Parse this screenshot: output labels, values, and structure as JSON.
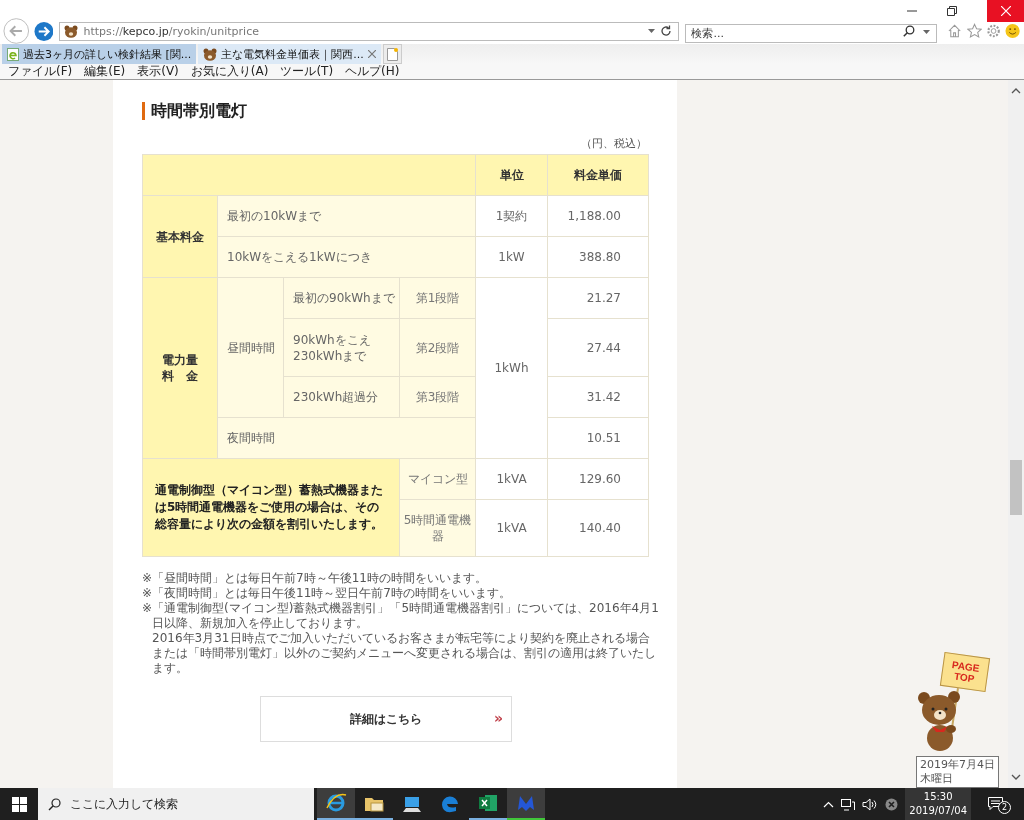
{
  "address_bar": {
    "url_prefix": "https://",
    "url_host": "kepco.jp",
    "url_path": "/ryokin/unitprice"
  },
  "search": {
    "placeholder": "検索..."
  },
  "tabs": [
    {
      "label": "過去3ヶ月の詳しい検針結果 [関...",
      "selected": false
    },
    {
      "label": "主な電気料金単価表｜関西...",
      "selected": true
    }
  ],
  "menu": [
    "ファイル(F)",
    "編集(E)",
    "表示(V)",
    "お気に入り(A)",
    "ツール(T)",
    "ヘルプ(H)"
  ],
  "page": {
    "heading": "時間帯別電灯",
    "unit_note": "（円、税込）",
    "table": {
      "rows": [
        [
          {
            "kind": "blank",
            "colspan": 4
          },
          {
            "kind": "header",
            "text": "単位"
          },
          {
            "kind": "header",
            "text": "料金単価"
          }
        ],
        [
          {
            "kind": "group",
            "text": "基本料金",
            "rowspan": 2
          },
          {
            "kind": "label",
            "text": "最初の10kWまで",
            "colspan": 3
          },
          {
            "kind": "value",
            "text": "1契約"
          },
          {
            "kind": "price",
            "text": "1,188.00"
          }
        ],
        [
          {
            "kind": "label",
            "text": "10kWをこえる1kWにつき",
            "colspan": 3
          },
          {
            "kind": "value",
            "text": "1kW"
          },
          {
            "kind": "price",
            "text": "388.80"
          }
        ],
        [
          {
            "kind": "group",
            "lines": [
              "電力量",
              "料　金"
            ],
            "rowspan": 4
          },
          {
            "kind": "label",
            "text": "昼間時間",
            "rowspan": 3
          },
          {
            "kind": "label",
            "text": "最初の90kWhまで"
          },
          {
            "kind": "stage",
            "text": "第1段階"
          },
          {
            "kind": "value",
            "text": "1kWh",
            "rowspan": 4
          },
          {
            "kind": "price",
            "text": "21.27"
          }
        ],
        [
          {
            "kind": "label",
            "lines": [
              "90kWhをこえ",
              "230kWhまで"
            ]
          },
          {
            "kind": "stage",
            "text": "第2段階"
          },
          {
            "kind": "price",
            "text": "27.44"
          }
        ],
        [
          {
            "kind": "label",
            "text": "230kWh超過分"
          },
          {
            "kind": "stage",
            "text": "第3段階"
          },
          {
            "kind": "price",
            "text": "31.42"
          }
        ],
        [
          {
            "kind": "label",
            "text": "夜間時間",
            "colspan": 3
          },
          {
            "kind": "price",
            "text": "10.51"
          }
        ],
        [
          {
            "kind": "note",
            "text": "通電制御型（マイコン型）蓄熱式機器または5時間通電機器をご使用の場合は、その総容量により次の金額を割引いたします。",
            "colspan": 3,
            "rowspan": 2
          },
          {
            "kind": "stage",
            "text": "マイコン型"
          },
          {
            "kind": "value",
            "text": "1kVA"
          },
          {
            "kind": "price",
            "text": "129.60"
          }
        ],
        [
          {
            "kind": "stage",
            "text": "5時間通電機器"
          },
          {
            "kind": "value",
            "text": "1kVA"
          },
          {
            "kind": "price",
            "text": "140.40"
          }
        ]
      ]
    },
    "notes": [
      {
        "mark": "※",
        "text": "「昼間時間」とは毎日午前7時～午後11時の時間をいいます。"
      },
      {
        "mark": "※",
        "text": "「夜間時間」とは毎日午後11時～翌日午前7時の時間をいいます。"
      },
      {
        "mark": "※",
        "text": "「通電制御型(マイコン型)蓄熱式機器割引」「5時間通電機器割引」については、2016年4月1日以降、新規加入を停止しております。",
        "continuation": "2016年3月31日時点でご加入いただいているお客さまが転宅等により契約を廃止される場合または「時間帯別電灯」以外のご契約メニューへ変更される場合は、割引の適用は終了いたします。"
      }
    ],
    "detail_link": {
      "label": "詳細はこちら",
      "arrow": "»"
    }
  },
  "page_top": {
    "lines": [
      "PAGE",
      "TOP"
    ]
  },
  "date_tooltip": {
    "lines": [
      "2019年7月4日",
      "木曜日"
    ]
  },
  "taskbar": {
    "search_placeholder": "ここに入力して検索",
    "apps": [
      {
        "kind": "ie",
        "active": true,
        "running": true
      },
      {
        "kind": "explorer",
        "active": false,
        "running": true
      },
      {
        "kind": "computer",
        "active": false,
        "running": false
      },
      {
        "kind": "edge",
        "active": false,
        "running": false
      },
      {
        "kind": "excel",
        "active": false,
        "running": true
      },
      {
        "kind": "malware",
        "active": true,
        "running": true
      }
    ],
    "clock": {
      "time": "15:30",
      "date": "2019/07/04"
    },
    "notifications": "2"
  }
}
